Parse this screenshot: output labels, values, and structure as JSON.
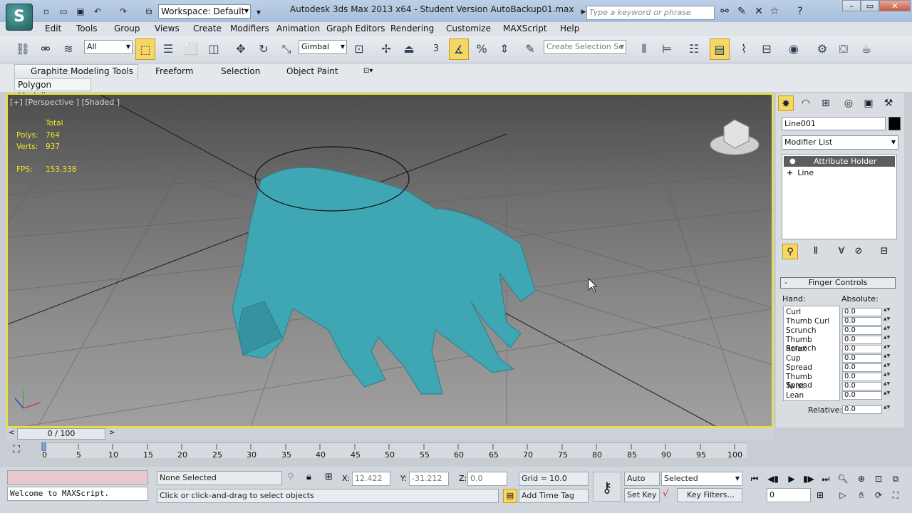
{
  "window": {
    "title": "Autodesk 3ds Max  2013 x64   - Student Version     AutoBackup01.max",
    "workspace": "Workspace: Default",
    "search_placeholder": "Type a keyword or phrase"
  },
  "menu": [
    "Edit",
    "Tools",
    "Group",
    "Views",
    "Create",
    "Modifiers",
    "Animation",
    "Graph Editors",
    "Rendering",
    "Customize",
    "MAXScript",
    "Help"
  ],
  "toolbar": {
    "selection_filter": "All",
    "coordinate_system": "Gimbal",
    "snap_number": "3",
    "named_selection_placeholder": "Create Selection Se"
  },
  "ribbon": {
    "tabs": [
      "Graphite Modeling Tools",
      "Freeform",
      "Selection",
      "Object Paint"
    ],
    "subtab": "Polygon Modeling"
  },
  "viewport": {
    "label": "[+] [Perspective ] [Shaded ]",
    "stats": {
      "total_label": "Total",
      "polys_label": "Polys:",
      "polys_value": "764",
      "verts_label": "Verts:",
      "verts_value": "937",
      "fps_label": "FPS:",
      "fps_value": "153.338"
    },
    "border_color": "#f1e41f",
    "mesh_color": "#3fa6b4"
  },
  "command_panel": {
    "object_name": "Line001",
    "object_color": "#000000",
    "modifier_list": "Modifier List",
    "stack": [
      "Attribute Holder",
      "Line"
    ],
    "rollout_title": "Finger Controls",
    "hand_label": "Hand:",
    "absolute_label": "Absolute:",
    "controls": [
      {
        "name": "Curl",
        "value": "0.0"
      },
      {
        "name": "Thumb Curl",
        "value": "0.0"
      },
      {
        "name": "Scrunch",
        "value": "0.0"
      },
      {
        "name": "Thumb Scrunch",
        "value": "0.0"
      },
      {
        "name": "Relax",
        "value": "0.0"
      },
      {
        "name": "Cup",
        "value": "0.0"
      },
      {
        "name": "Spread",
        "value": "0.0"
      },
      {
        "name": "Thumb Spread",
        "value": "0.0"
      },
      {
        "name": "Twist",
        "value": "0.0"
      },
      {
        "name": "Lean",
        "value": "0.0"
      }
    ],
    "relative_label": "Relative:",
    "relative_value": "0.0"
  },
  "timeline": {
    "slider": "0 / 100",
    "ticks": [
      "0",
      "5",
      "10",
      "15",
      "20",
      "25",
      "30",
      "35",
      "40",
      "45",
      "50",
      "55",
      "60",
      "65",
      "70",
      "75",
      "80",
      "85",
      "90",
      "95",
      "100"
    ]
  },
  "status": {
    "maxscript_output": "Welcome to MAXScript.",
    "selection": "None Selected",
    "prompt": "Click or click-and-drag to select objects",
    "x_label": "X:",
    "x_value": "12.422",
    "y_label": "Y:",
    "y_value": "-31.212",
    "z_label": "Z:",
    "z_value": "0.0",
    "grid": "Grid = 10.0",
    "add_time_tag": "Add Time Tag",
    "auto_key": "Auto Key",
    "set_key": "Set Key",
    "key_mode": "Selected",
    "key_filters": "Key Filters...",
    "frame": "0"
  }
}
